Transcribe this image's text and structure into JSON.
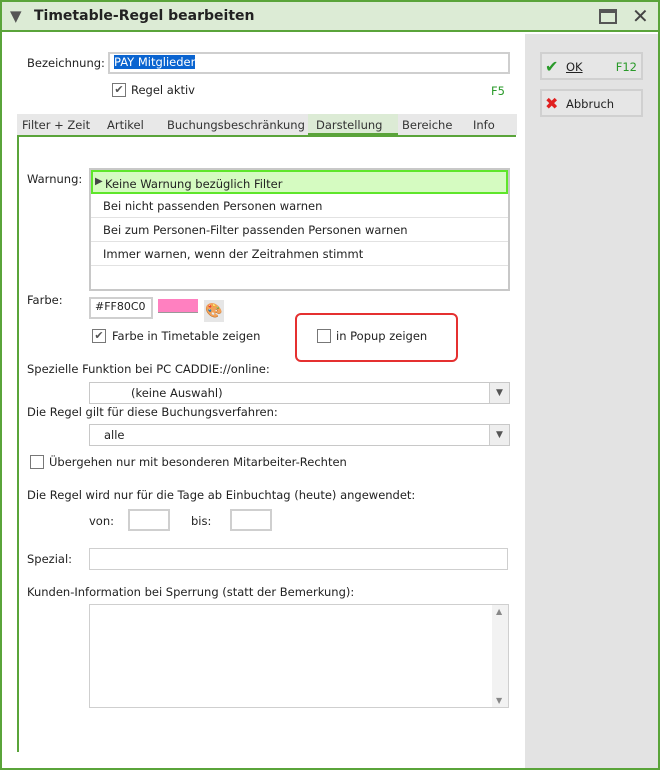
{
  "window": {
    "title": "Timetable-Regel bearbeiten"
  },
  "form": {
    "name_label": "Bezeichnung:",
    "name_value": "PAY Mitglieder",
    "active_label": "Regel aktiv",
    "active_checked": true,
    "active_shortcut": "F5"
  },
  "buttons": {
    "ok": "OK",
    "ok_shortcut": "F12",
    "cancel": "Abbruch"
  },
  "tabs": [
    "Filter + Zeit",
    "Artikel",
    "Buchungsbeschränkung",
    "Darstellung",
    "Bereiche",
    "Info"
  ],
  "active_tab": "Darstellung",
  "warning": {
    "label": "Warnung:",
    "options": [
      "Keine Warnung bezüglich Filter",
      "Bei nicht passenden Personen warnen",
      "Bei zum Personen-Filter passenden Personen warnen",
      "Immer warnen, wenn der Zeitrahmen stimmt"
    ],
    "selected": 0
  },
  "color": {
    "label": "Farbe:",
    "value": "#FF80C0",
    "swatch": "#ff80c0",
    "show_timetable_label": "Farbe in Timetable zeigen",
    "show_popup_label": "in Popup zeigen"
  },
  "online": {
    "label": "Spezielle Funktion bei PC CADDIE://online:",
    "value": "(keine Auswahl)"
  },
  "booking": {
    "label": "Die Regel gilt für diese Buchungsverfahren:",
    "value": "alle"
  },
  "override": {
    "label": "Übergehen nur mit besonderen Mitarbeiter-Rechten"
  },
  "days": {
    "label": "Die Regel wird nur für die Tage ab Einbuchtag (heute) angewendet:",
    "from_label": "von:",
    "to_label": "bis:",
    "from": "",
    "to": ""
  },
  "special": {
    "label": "Spezial:",
    "value": ""
  },
  "customer_info": {
    "label": "Kunden-Information bei Sperrung (statt der Bemerkung):",
    "value": ""
  }
}
